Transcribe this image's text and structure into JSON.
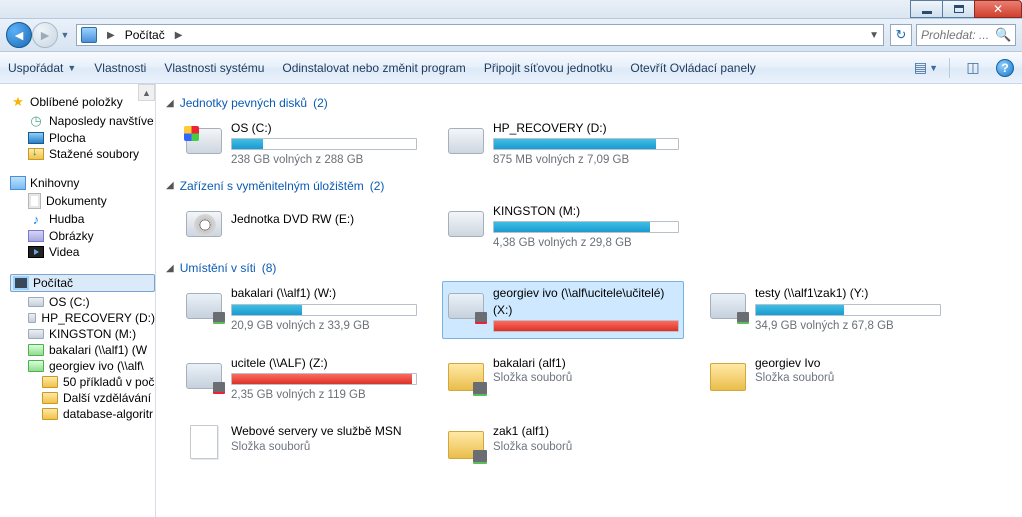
{
  "window": {
    "title": ""
  },
  "nav": {
    "breadcrumb": "Počítač",
    "refresh_hint": "⟳",
    "search_placeholder": "Prohledat: ..."
  },
  "toolbar": {
    "organize": "Uspořádat",
    "properties": "Vlastnosti",
    "sys_properties": "Vlastnosti systému",
    "uninstall": "Odinstalovat nebo změnit program",
    "map_drive": "Připojit síťovou jednotku",
    "control_panel": "Otevřít Ovládací panely"
  },
  "navpane": {
    "favorites": "Oblíbené položky",
    "recent": "Naposledy navštíve",
    "desktop": "Plocha",
    "downloads": "Stažené soubory",
    "libraries": "Knihovny",
    "documents": "Dokumenty",
    "music": "Hudba",
    "pictures": "Obrázky",
    "videos": "Videa",
    "computer": "Počítač",
    "d_c": "OS (C:)",
    "d_d": "HP_RECOVERY (D:)",
    "d_m": "KINGSTON (M:)",
    "d_w": "bakalari (\\\\alf1) (W",
    "d_x": "georgiev ivo (\\\\alf\\",
    "sub1": "50 příkladů v poč",
    "sub2": "Další vzdělávání",
    "sub3": "database-algoritr"
  },
  "groups": {
    "hdd": {
      "label": "Jednotky pevných disků",
      "count": "(2)"
    },
    "rem": {
      "label": "Zařízení s vyměnitelným úložištěm",
      "count": "(2)"
    },
    "net": {
      "label": "Umístění v síti",
      "count": "(8)"
    }
  },
  "drives": {
    "c": {
      "name": "OS (C:)",
      "free": "238 GB volných z 288 GB",
      "fill": 17,
      "color": "blue",
      "icon": "win"
    },
    "d": {
      "name": "HP_RECOVERY (D:)",
      "free": "875 MB volných z 7,09 GB",
      "fill": 88,
      "color": "blue",
      "icon": "hdd"
    },
    "dvd": {
      "name": "Jednotka DVD RW (E:)",
      "free": "",
      "fill": 0,
      "color": "",
      "icon": "dvd"
    },
    "m": {
      "name": "KINGSTON (M:)",
      "free": "4,38 GB volných z 29,8 GB",
      "fill": 85,
      "color": "blue",
      "icon": "usb"
    },
    "w": {
      "name": "bakalari (\\\\alf1) (W:)",
      "free": "20,9 GB volných z 33,9 GB",
      "fill": 38,
      "color": "blue",
      "icon": "net"
    },
    "x": {
      "name": "georgiev ivo (\\\\alf\\ucitele\\učitelé) (X:)",
      "free": "",
      "fill": 100,
      "color": "red",
      "icon": "net",
      "selected": true
    },
    "y": {
      "name": "testy (\\\\alf1\\zak1) (Y:)",
      "free": "34,9 GB volných z 67,8 GB",
      "fill": 48,
      "color": "blue",
      "icon": "net"
    },
    "z": {
      "name": "ucitele (\\\\ALF) (Z:)",
      "free": "2,35 GB volných z 119 GB",
      "fill": 98,
      "color": "red",
      "icon": "net"
    },
    "msn": {
      "name": "Webové servery ve službě MSN",
      "sub": "Složka souborů",
      "icon": "page"
    },
    "bak": {
      "name": "bakalari (alf1)",
      "sub": "Složka souborů",
      "icon": "netfolder"
    },
    "zak": {
      "name": "zak1 (alf1)",
      "sub": "Složka souborů",
      "icon": "netfolder"
    },
    "geo": {
      "name": "georgiev Ivo",
      "sub": "Složka souborů",
      "icon": "folder"
    }
  },
  "misc": {
    "folder_kind": "Složka souborů"
  }
}
